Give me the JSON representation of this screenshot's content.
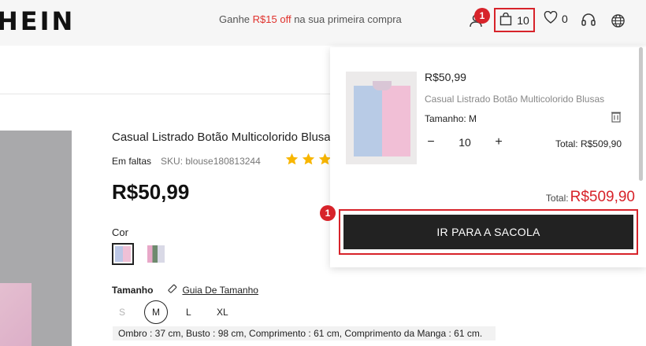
{
  "header": {
    "logo": "HEIN",
    "promo_prefix": "Ganhe ",
    "promo_highlight": "R$15 off",
    "promo_suffix": " na sua primeira compra",
    "bag_count": "10",
    "wishlist_count": "0",
    "accent_color": "#d7232a"
  },
  "markers": {
    "bag": "1",
    "go_to_bag": "1"
  },
  "product": {
    "title": "Casual Listrado Botão Multicolorido Blusas",
    "stock_status": "Em faltas",
    "sku": "SKU: blouse180813244",
    "stars": 3,
    "price": "R$50,99",
    "color_label": "Cor",
    "size_label": "Tamanho",
    "size_guide": "Guia De Tamanho",
    "sizes": [
      "S",
      "M",
      "L",
      "XL"
    ],
    "selected_size": "M",
    "measurements": "Ombro : 37 cm,  Busto : 98 cm,  Comprimento : 61 cm,  Comprimento da Manga : 61 cm."
  },
  "cart_popup": {
    "item_price": "R$50,99",
    "item_name": "Casual Listrado Botão Multicolorido Blusas",
    "item_size": "Tamanho: M",
    "quantity": "10",
    "decrement": "−",
    "increment": "+",
    "item_total": "Total: R$509,90",
    "total_label": "Total:",
    "total_value": "R$509,90",
    "go_button": "IR PARA A SACOLA"
  }
}
